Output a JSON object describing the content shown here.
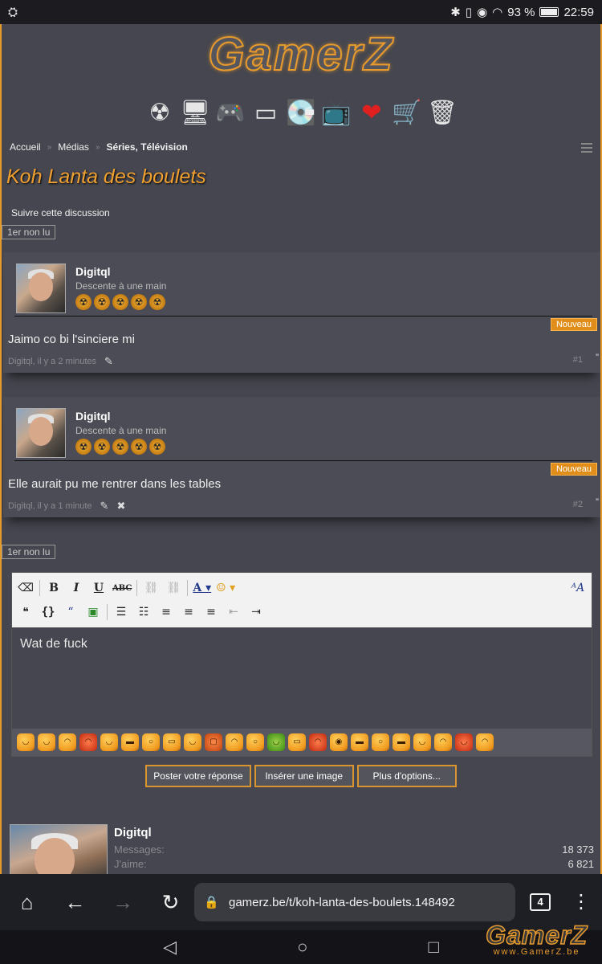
{
  "status_bar": {
    "battery": "93 %",
    "time": "22:59",
    "icons": [
      "bluetooth-icon",
      "vibrate-icon",
      "eye-icon",
      "wifi-icon"
    ]
  },
  "site": {
    "logo": "GamerZ"
  },
  "nav_icons": [
    "radiation-icon",
    "computer-icon",
    "gamepad-icon",
    "psp-icon",
    "hard-drive-icon",
    "tv-icon",
    "heart-icon",
    "shopping-cart-icon",
    "trash-icon"
  ],
  "breadcrumb": {
    "items": [
      "Accueil",
      "Médias",
      "Séries, Télévision"
    ]
  },
  "thread": {
    "title": "Koh Lanta des boulets",
    "follow_label": "Suivre cette discussion",
    "unread_label": "1er non lu"
  },
  "posts": [
    {
      "author": "Digitql",
      "rank": "Descente à une main",
      "badge": "Nouveau",
      "text": "Jaimo co bi l'sinciere mi",
      "meta": "Digitql, il y a 2 minutes",
      "number": "#1"
    },
    {
      "author": "Digitql",
      "rank": "Descente à une main",
      "badge": "Nouveau",
      "text": "Elle aurait pu me rentrer dans les tables",
      "meta": "Digitql, il y a 1 minute",
      "number": "#2"
    }
  ],
  "editor": {
    "content": "Wat de fuck",
    "toolbar_row1": [
      "eraser-icon",
      "bold",
      "italic",
      "underline",
      "strikethrough",
      "link-icon",
      "unlink-icon",
      "text-color-icon",
      "smiley-icon"
    ],
    "toolbar_row2": [
      "quote-icon",
      "code-icon",
      "blockquote-icon",
      "image-icon",
      "bullet-list-icon",
      "numbered-list-icon",
      "align-left-icon",
      "align-center-icon",
      "align-right-icon",
      "outdent-icon",
      "indent-icon"
    ],
    "smilies_count": 24
  },
  "actions": {
    "post_reply": "Poster votre réponse",
    "insert_image": "Insérer une image",
    "more_options": "Plus d'options..."
  },
  "user_card": {
    "name": "Digitql",
    "messages_label": "Messages:",
    "messages_value": "18 373",
    "likes_label": "J'aime:",
    "likes_value": "6 821"
  },
  "browser": {
    "url": "gamerz.be/t/koh-lanta-des-boulets.148492",
    "tab_count": "4"
  },
  "watermark": {
    "logo": "GamerZ",
    "url": "www.GamerZ.be"
  },
  "colors": {
    "accent": "#e89a2c",
    "background": "#45464f",
    "title": "#f0a030"
  }
}
